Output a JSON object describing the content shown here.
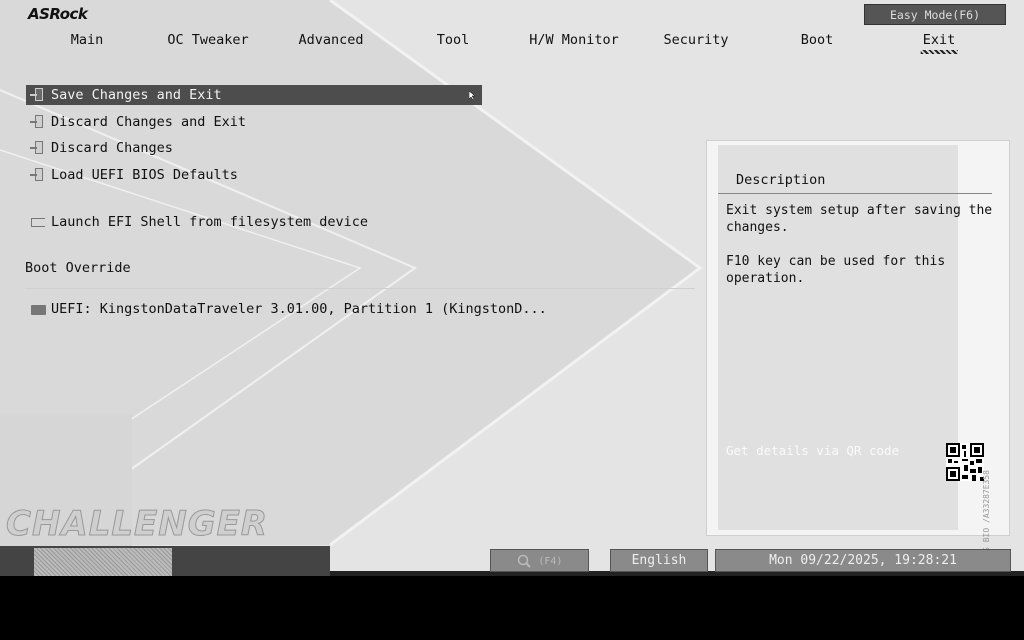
{
  "header": {
    "logo": "ASRock",
    "easy_mode_label": "Easy Mode(F6)",
    "tabs": [
      "Main",
      "OC Tweaker",
      "Advanced",
      "Tool",
      "H/W Monitor",
      "Security",
      "Boot",
      "Exit"
    ],
    "active_tab": "Exit"
  },
  "menu": {
    "items": [
      {
        "label": "Save Changes and Exit",
        "icon": "exit-door-icon",
        "selected": true
      },
      {
        "label": "Discard Changes and Exit",
        "icon": "exit-door-icon"
      },
      {
        "label": "Discard Changes",
        "icon": "exit-door-icon"
      },
      {
        "label": "Load UEFI BIOS Defaults",
        "icon": "exit-door-icon"
      },
      {
        "label": "Launch EFI Shell from filesystem device",
        "icon": "shell-icon"
      }
    ],
    "boot_override_title": "Boot Override",
    "boot_devices": [
      {
        "label": "UEFI: KingstonDataTraveler 3.01.00, Partition 1 (KingstonD...",
        "icon": "drive-icon"
      }
    ]
  },
  "description": {
    "title": "Description",
    "text": "Exit system setup after saving the changes.\n\nF10 key can be used for this operation.",
    "qr_label": "Get details via QR code",
    "access_text": "ACCESS BIO /A33287E358"
  },
  "branding": {
    "board_series": "CHALLENGER"
  },
  "footer": {
    "search_key": "(F4)",
    "language": "English",
    "datetime": "Mon 09/22/2025, 19:28:21"
  },
  "colors": {
    "background": "#e4e4e4",
    "selected_row": "#4d4d4d",
    "button_bg": "#8a8a8a"
  }
}
